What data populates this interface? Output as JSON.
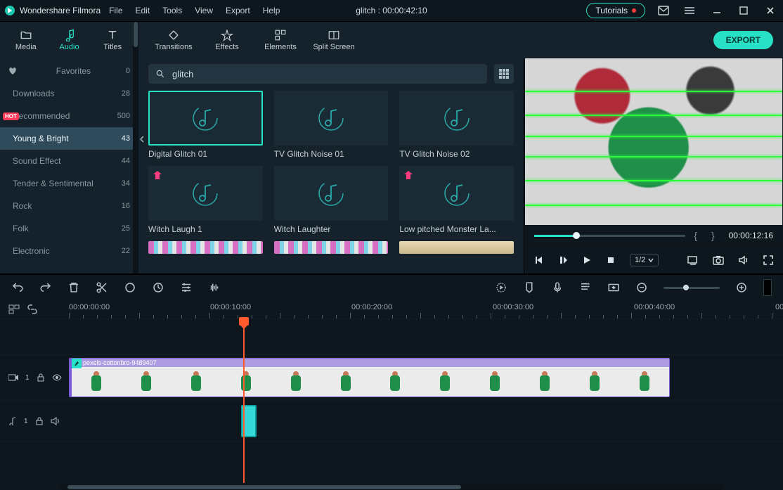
{
  "app_name": "Wondershare Filmora",
  "menubar": {
    "file": "File",
    "edit": "Edit",
    "tools": "Tools",
    "view": "View",
    "export": "Export",
    "help": "Help"
  },
  "project_status": "glitch : 00:00:42:10",
  "tutorials_label": "Tutorials",
  "main_tabs": {
    "media": "Media",
    "audio": "Audio",
    "titles": "Titles",
    "transitions": "Transitions",
    "effects": "Effects",
    "elements": "Elements",
    "split": "Split Screen"
  },
  "export_button": "EXPORT",
  "categories": [
    {
      "label": "Favorites",
      "count": 0,
      "fav": true
    },
    {
      "label": "Downloads",
      "count": 28
    },
    {
      "label": "Recommended",
      "count": 500,
      "hot": true
    },
    {
      "label": "Young & Bright",
      "count": 43,
      "selected": true
    },
    {
      "label": "Sound Effect",
      "count": 44
    },
    {
      "label": "Tender & Sentimental",
      "count": 34
    },
    {
      "label": "Rock",
      "count": 16
    },
    {
      "label": "Folk",
      "count": 25
    },
    {
      "label": "Electronic",
      "count": 22
    }
  ],
  "hot_label": "HOT",
  "search": {
    "value": "glitch"
  },
  "assets": [
    {
      "name": "Digital Glitch 01",
      "sel": true
    },
    {
      "name": "TV Glitch Noise 01"
    },
    {
      "name": "TV Glitch Noise 02"
    },
    {
      "name": "Witch Laugh 1",
      "dl": true
    },
    {
      "name": "Witch Laughter"
    },
    {
      "name": "Low pitched Monster La...",
      "dl": true
    }
  ],
  "preview": {
    "time": "00:00:12:16",
    "zoom": "1/2"
  },
  "ruler": {
    "marks": [
      "00:00:00:00",
      "00:00:10:00",
      "00:00:20:00",
      "00:00:30:00",
      "00:00:40:00",
      "00:"
    ]
  },
  "video_track": {
    "label": "1",
    "clip_name": "pexels-cottonbro-9489407"
  },
  "audio_track": {
    "label": "1"
  }
}
